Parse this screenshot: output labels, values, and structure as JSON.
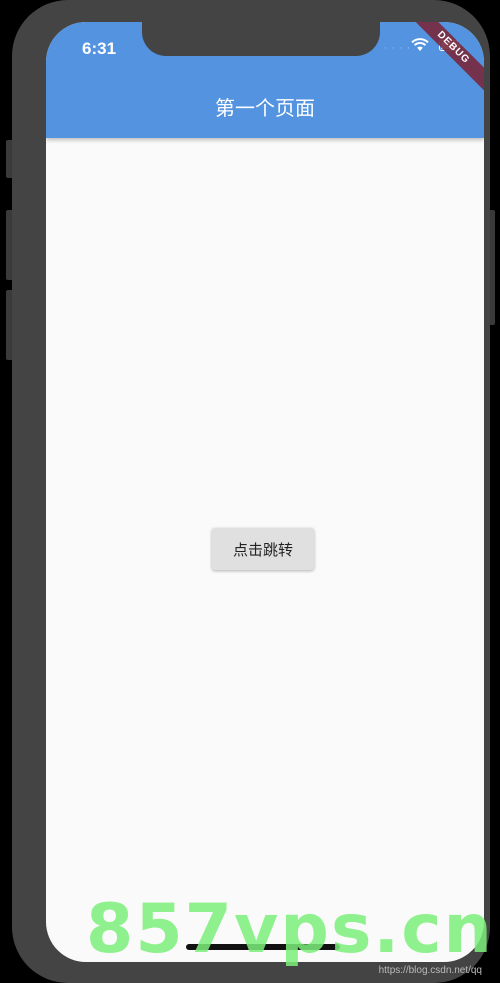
{
  "status_bar": {
    "time": "6:31",
    "signal_dots": "· · · ·",
    "wifi_icon": "wifi-icon",
    "battery_icon": "battery-icon"
  },
  "debug_banner": {
    "label": "DEBUG"
  },
  "app_bar": {
    "title": "第一个页面",
    "color": "#5393e0"
  },
  "main": {
    "button_label": "点击跳转"
  },
  "overlay": {
    "watermark": "857vps.cn",
    "credit": "https://blog.csdn.net/qq"
  }
}
